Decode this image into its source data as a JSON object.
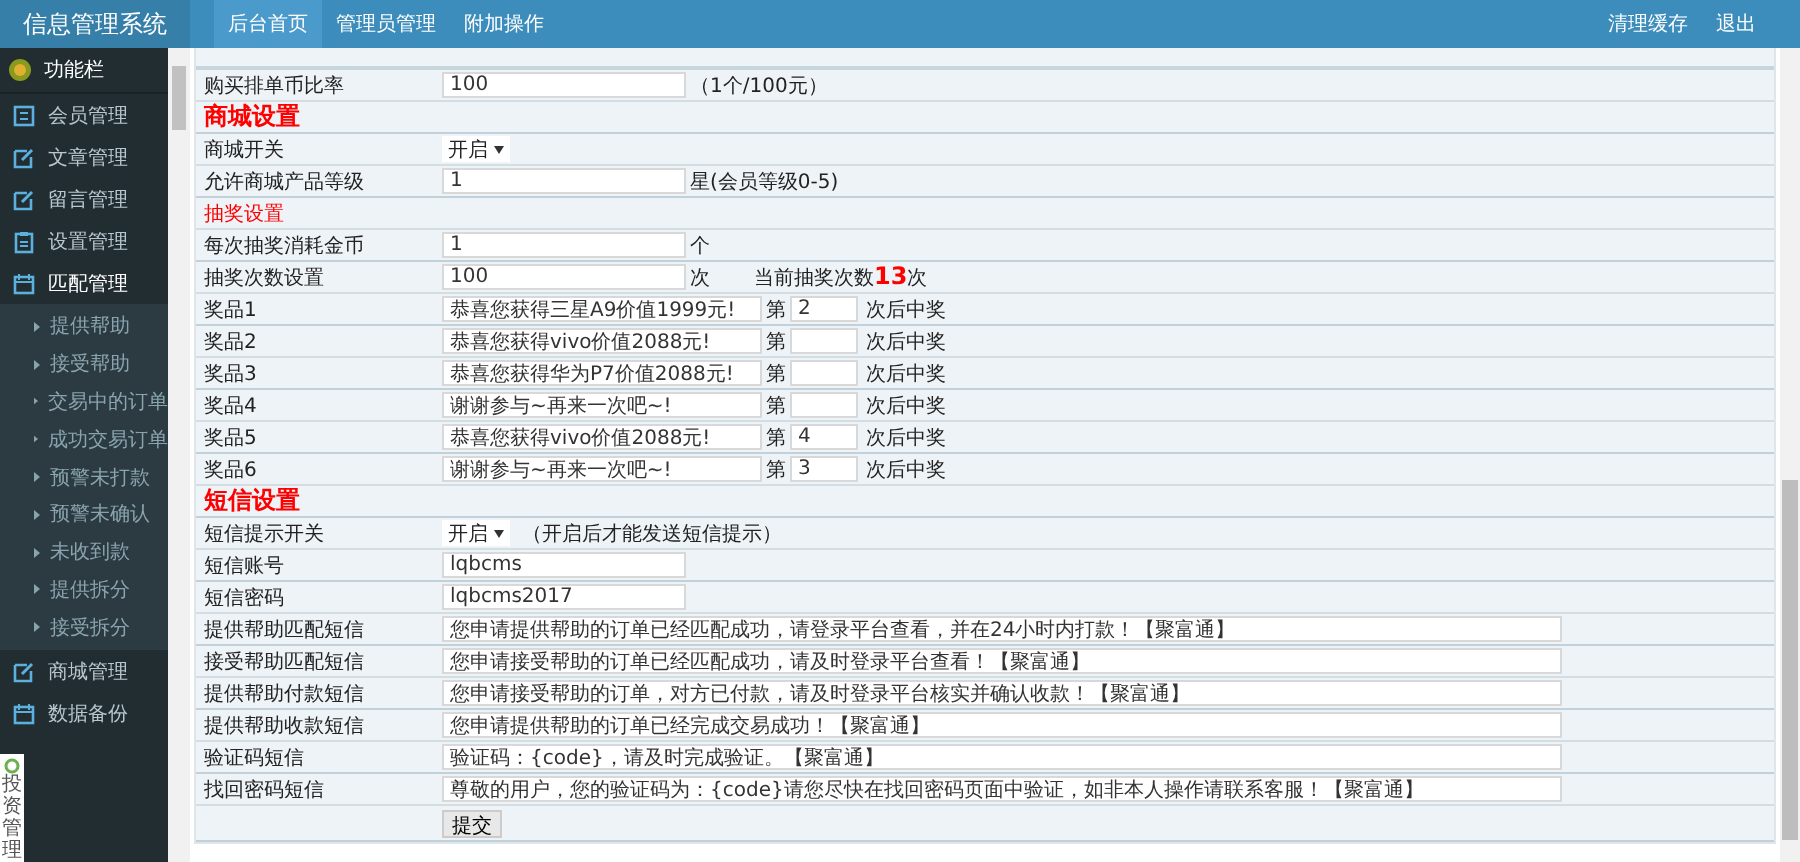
{
  "app": {
    "title": "信息管理系统"
  },
  "top_nav": {
    "items": [
      {
        "label": "后台首页",
        "selected": true
      },
      {
        "label": "管理员管理",
        "selected": false
      },
      {
        "label": "附加操作",
        "selected": false
      }
    ],
    "right_links": [
      "清理缓存",
      "退出"
    ]
  },
  "sidebar": {
    "header": "功能栏",
    "items": [
      {
        "label": "会员管理",
        "expanded": false
      },
      {
        "label": "文章管理",
        "expanded": false
      },
      {
        "label": "留言管理",
        "expanded": false
      },
      {
        "label": "设置管理",
        "expanded": false
      },
      {
        "label": "匹配管理",
        "expanded": true,
        "children": [
          "提供帮助",
          "接受帮助",
          "交易中的订单",
          "成功交易订单",
          "预警未打款",
          "预警未确认",
          "未收到款",
          "提供拆分",
          "接受拆分"
        ]
      },
      {
        "label": "商城管理",
        "expanded": false
      },
      {
        "label": "数据备份",
        "expanded": false
      }
    ]
  },
  "float_widget": {
    "label": "投资管理"
  },
  "form": {
    "rows": [
      {
        "kind": "text",
        "label": "购买排单币比率",
        "value": "100",
        "suffix": "（1个/100元）"
      },
      {
        "kind": "section",
        "title": "商城设置"
      },
      {
        "kind": "select",
        "label": "商城开关",
        "value": "开启"
      },
      {
        "kind": "text",
        "label": "允许商城产品等级",
        "value": "1",
        "suffix": "星(会员等级0-5)"
      },
      {
        "kind": "subsection",
        "title": "抽奖设置"
      },
      {
        "kind": "text",
        "label": "每次抽奖消耗金币",
        "value": "1",
        "suffix": "个"
      },
      {
        "kind": "text",
        "label": "抽奖次数设置",
        "value": "100",
        "suffix": "次",
        "note": "当前抽奖次数**13**次"
      },
      {
        "kind": "prize",
        "label": "奖品1",
        "value": "恭喜您获得三星A9价值1999元!",
        "prefix": "第",
        "count": "2",
        "suffix": "次后中奖"
      },
      {
        "kind": "prize",
        "label": "奖品2",
        "value": "恭喜您获得vivo价值2088元!",
        "prefix": "第",
        "suffix": "次后中奖"
      },
      {
        "kind": "prize",
        "label": "奖品3",
        "value": "恭喜您获得华为P7价值2088元!",
        "prefix": "第",
        "suffix": "次后中奖"
      },
      {
        "kind": "prize",
        "label": "奖品4",
        "value": "谢谢参与~再来一次吧~!",
        "prefix": "第",
        "suffix": "次后中奖"
      },
      {
        "kind": "prize",
        "label": "奖品5",
        "value": "恭喜您获得vivo价值2088元!",
        "prefix": "第",
        "count": "4",
        "suffix": "次后中奖"
      },
      {
        "kind": "prize",
        "label": "奖品6",
        "value": "谢谢参与~再来一次吧~!",
        "prefix": "第",
        "count": "3",
        "suffix": "次后中奖"
      },
      {
        "kind": "section",
        "title": "短信设置"
      },
      {
        "kind": "select",
        "label": "短信提示开关",
        "value": "开启",
        "suffix": "（开启后才能发送短信提示）"
      },
      {
        "kind": "text",
        "label": "短信账号",
        "value": "lqbcms"
      },
      {
        "kind": "text",
        "label": "短信密码",
        "value": "lqbcms2017"
      },
      {
        "kind": "message",
        "label": "提供帮助匹配短信",
        "value": "您申请提供帮助的订单已经匹配成功，请登录平台查看，并在24小时内打款！【聚富通】"
      },
      {
        "kind": "message",
        "label": "接受帮助匹配短信",
        "value": "您申请接受帮助的订单已经匹配成功，请及时登录平台查看！【聚富通】"
      },
      {
        "kind": "message",
        "label": "提供帮助付款短信",
        "value": "您申请接受帮助的订单，对方已付款，请及时登录平台核实并确认收款！【聚富通】"
      },
      {
        "kind": "message",
        "label": "提供帮助收款短信",
        "value": "您申请提供帮助的订单已经完成交易成功！【聚富通】"
      },
      {
        "kind": "message",
        "label": "验证码短信",
        "value": "验证码：{code}，请及时完成验证。【聚富通】"
      },
      {
        "kind": "message",
        "label": "找回密码短信",
        "value": "尊敬的用户，您的验证码为：{code}请您尽快在找回密码页面中验证，如非本人操作请联系客服！【聚富通】"
      }
    ],
    "submit": "提交"
  }
}
